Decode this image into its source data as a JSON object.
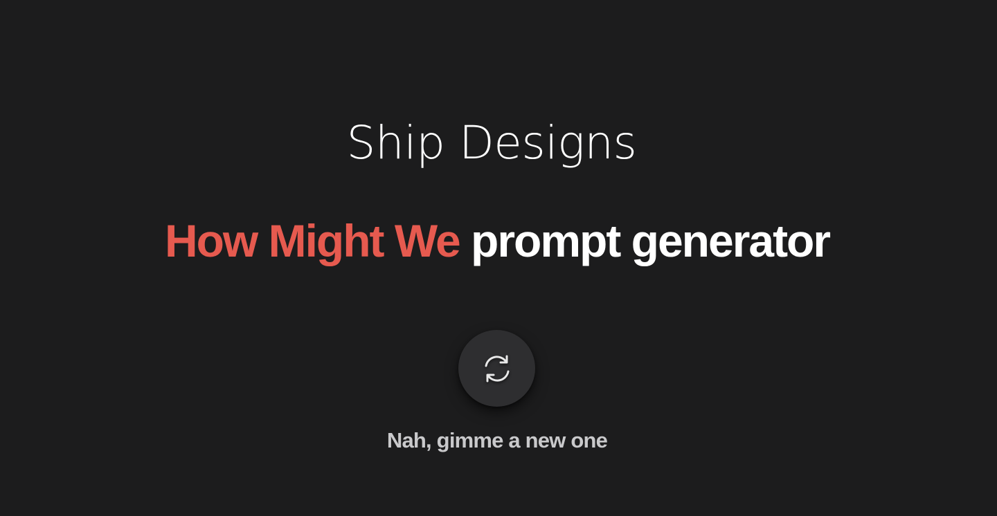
{
  "header": {
    "brand": "Ship Designs"
  },
  "headline": {
    "accent": "How Might We",
    "rest": "prompt generator"
  },
  "refresh": {
    "icon": "refresh-icon",
    "caption": "Nah, gimme a new one"
  },
  "colors": {
    "background": "#1c1c1d",
    "accent": "#e65a4f",
    "button": "#2e2e30",
    "caption": "#c9c9cb"
  }
}
